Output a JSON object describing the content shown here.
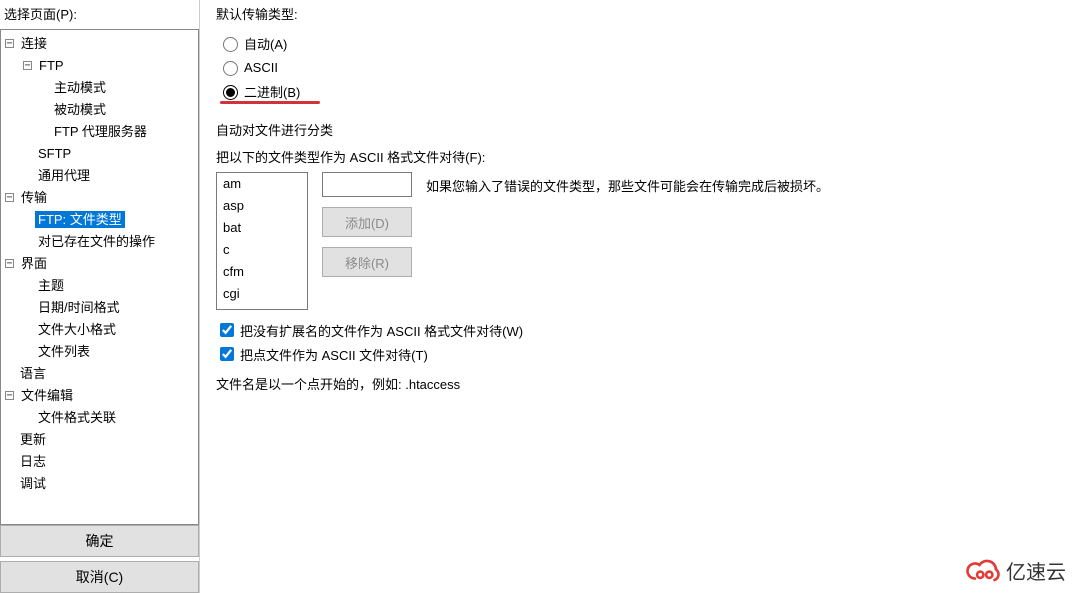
{
  "left": {
    "select_label": "选择页面(P):",
    "ok_btn": "确定",
    "cancel_btn": "取消(C)"
  },
  "tree": {
    "connection": "连接",
    "ftp": "FTP",
    "active_mode": "主动模式",
    "passive_mode": "被动模式",
    "ftp_proxy": "FTP 代理服务器",
    "sftp": "SFTP",
    "generic_proxy": "通用代理",
    "transfer": "传输",
    "ftp_file_types": "FTP: 文件类型",
    "file_exists": "对已存在文件的操作",
    "interface": "界面",
    "theme": "主题",
    "datetime": "日期/时间格式",
    "filesize": "文件大小格式",
    "filelist": "文件列表",
    "language": "语言",
    "file_edit": "文件编辑",
    "file_assoc": "文件格式关联",
    "update": "更新",
    "log": "日志",
    "debug": "调试"
  },
  "right": {
    "default_transfer_type": "默认传输类型:",
    "radio_auto": "自动(A)",
    "radio_ascii": "ASCII",
    "radio_binary": "二进制(B)",
    "auto_classify": "自动对文件进行分类",
    "treat_as_ascii_label": "把以下的文件类型作为 ASCII 格式文件对待(F):",
    "list_items": [
      "am",
      "asp",
      "bat",
      "c",
      "cfm",
      "cgi"
    ],
    "hint": "如果您输入了错误的文件类型，那些文件可能会在传输完成后被损坏。",
    "add_btn": "添加(D)",
    "remove_btn": "移除(R)",
    "chk_no_ext": "把没有扩展名的文件作为 ASCII 格式文件对待(W)",
    "chk_dotfiles": "把点文件作为 ASCII 文件对待(T)",
    "note": "文件名是以一个点开始的，例如: .htaccess"
  },
  "brand": "亿速云"
}
